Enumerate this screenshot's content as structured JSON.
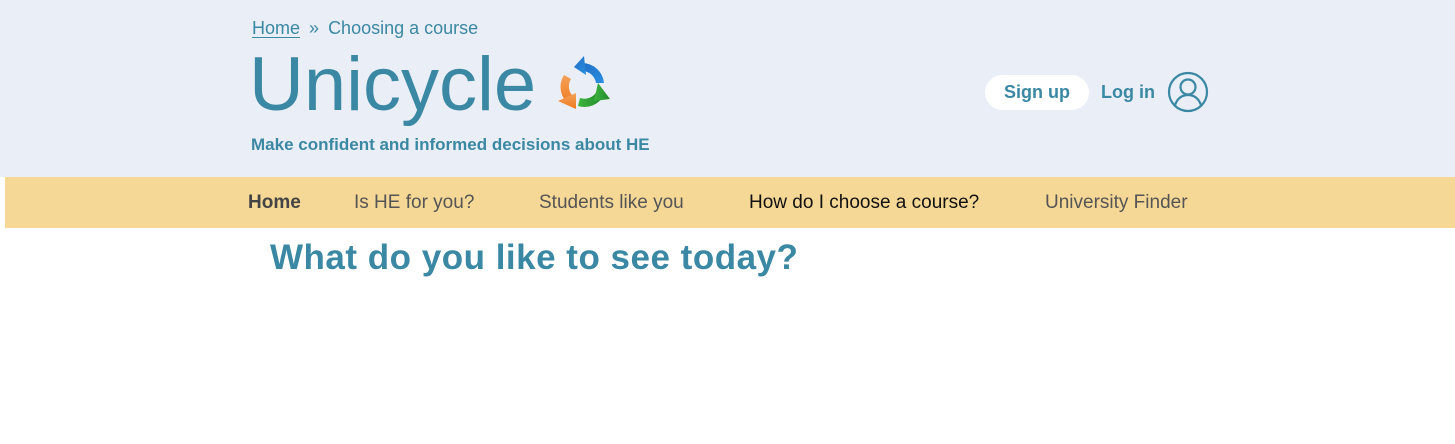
{
  "breadcrumb": {
    "home": "Home",
    "separator": "»",
    "current": "Choosing a course"
  },
  "logo": {
    "text": "Unicycle",
    "icon": "recycle-arrows-icon"
  },
  "tagline": "Make confident and informed decisions about HE",
  "auth": {
    "signup_label": "Sign up",
    "login_label": "Log in",
    "user_icon": "user-icon"
  },
  "nav": {
    "items": [
      {
        "label": "Home"
      },
      {
        "label": "Is HE for you?"
      },
      {
        "label": "Students like you"
      },
      {
        "label": "How do I choose a course?"
      },
      {
        "label": "University Finder"
      }
    ]
  },
  "main": {
    "heading": "What do you like to see today?"
  },
  "colors": {
    "header_bg": "#eaeef6",
    "nav_bg": "#f6d896",
    "brand_teal": "#3a88a3",
    "white": "#ffffff"
  }
}
